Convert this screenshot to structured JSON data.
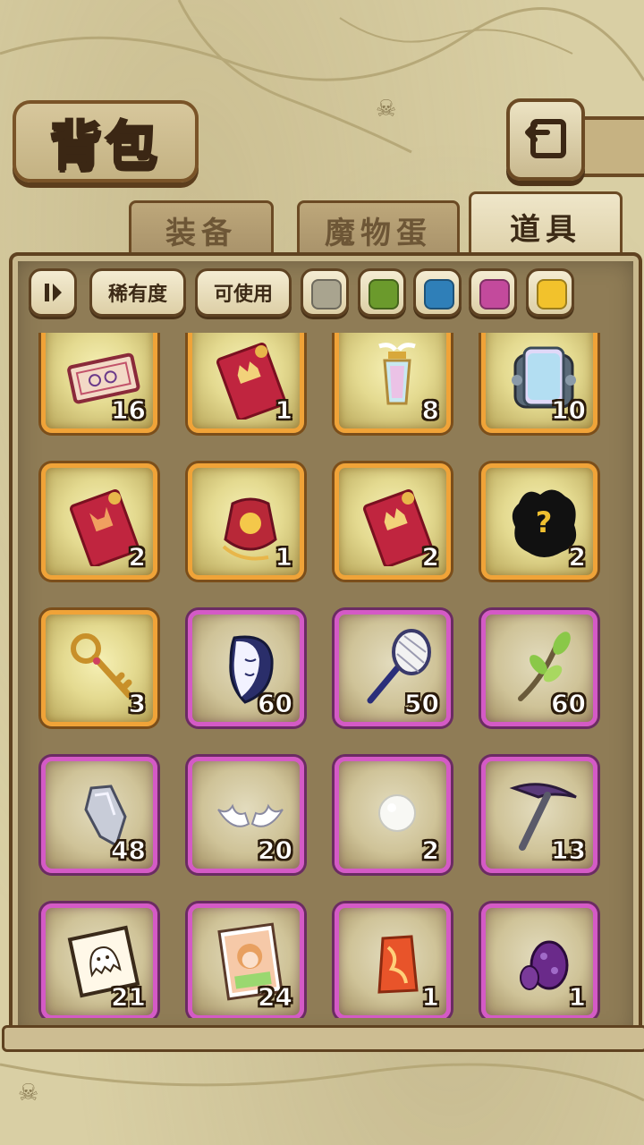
{
  "header": {
    "title": "背包",
    "back_icon": "back-arrow-icon"
  },
  "tabs": [
    {
      "label": "装备",
      "active": false
    },
    {
      "label": "魔物蛋",
      "active": false
    },
    {
      "label": "道具",
      "active": true
    }
  ],
  "filters": {
    "sort_icon": "sort-toggle-icon",
    "rarity_label": "稀有度",
    "usable_label": "可使用",
    "colors": [
      {
        "name": "grey",
        "hex": "#a9a48f"
      },
      {
        "name": "green",
        "hex": "#6b9a2c"
      },
      {
        "name": "blue",
        "hex": "#2f7fb8"
      },
      {
        "name": "pink",
        "hex": "#c34a9c"
      },
      {
        "name": "yellow",
        "hex": "#f2c22c"
      }
    ]
  },
  "items": [
    {
      "icon": "ticket-icon",
      "count": "16",
      "rarity": "gold"
    },
    {
      "icon": "red-envelope-icon",
      "count": "1",
      "rarity": "gold"
    },
    {
      "icon": "winged-lantern-icon",
      "count": "8",
      "rarity": "gold"
    },
    {
      "icon": "crystal-capsule-icon",
      "count": "10",
      "rarity": "gold"
    },
    {
      "icon": "fox-red-envelope-icon",
      "count": "2",
      "rarity": "gold"
    },
    {
      "icon": "lucky-bag-icon",
      "count": "1",
      "rarity": "gold"
    },
    {
      "icon": "red-envelope-icon",
      "count": "2",
      "rarity": "gold"
    },
    {
      "icon": "mystery-silhouette-icon",
      "count": "2",
      "rarity": "gold"
    },
    {
      "icon": "golden-key-icon",
      "count": "3",
      "rarity": "gold"
    },
    {
      "icon": "moon-mask-icon",
      "count": "60",
      "rarity": "purple"
    },
    {
      "icon": "bug-net-icon",
      "count": "50",
      "rarity": "purple"
    },
    {
      "icon": "sprout-branch-icon",
      "count": "60",
      "rarity": "purple"
    },
    {
      "icon": "silver-shard-icon",
      "count": "48",
      "rarity": "purple"
    },
    {
      "icon": "white-wings-icon",
      "count": "20",
      "rarity": "purple"
    },
    {
      "icon": "white-pearl-icon",
      "count": "2",
      "rarity": "purple"
    },
    {
      "icon": "pickaxe-icon",
      "count": "13",
      "rarity": "purple"
    },
    {
      "icon": "ghost-card-icon",
      "count": "21",
      "rarity": "purple"
    },
    {
      "icon": "character-card-icon",
      "count": "24",
      "rarity": "purple"
    },
    {
      "icon": "fire-crystal-icon",
      "count": "1",
      "rarity": "purple"
    },
    {
      "icon": "purple-egg-icon",
      "count": "1",
      "rarity": "purple"
    }
  ]
}
